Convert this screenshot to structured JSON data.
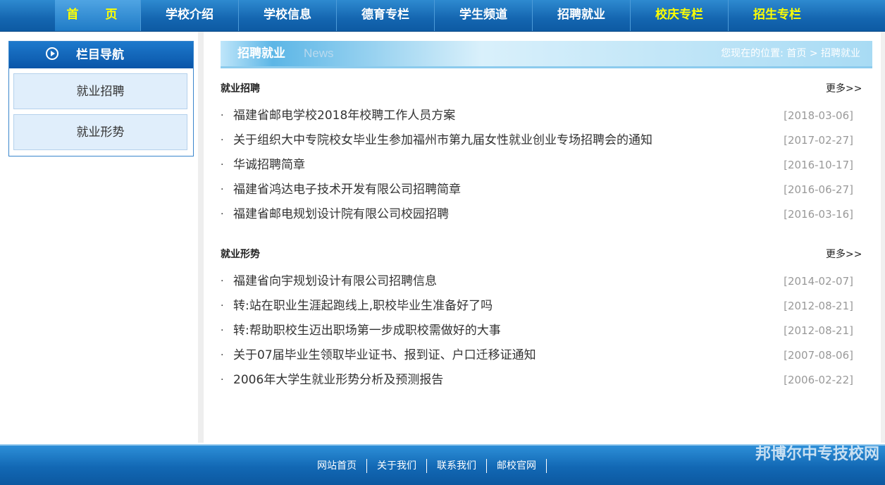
{
  "nav": {
    "items": [
      {
        "label": "首 页",
        "color": "#ffff00"
      },
      {
        "label": "学校介绍"
      },
      {
        "label": "学校信息"
      },
      {
        "label": "德育专栏"
      },
      {
        "label": "学生频道"
      },
      {
        "label": "招聘就业"
      },
      {
        "label": "校庆专栏",
        "color": "#ffff00"
      },
      {
        "label": "招生专栏",
        "color": "#ffff00"
      }
    ]
  },
  "sidebar": {
    "title": "栏目导航",
    "items": [
      "就业招聘",
      "就业形势"
    ]
  },
  "content": {
    "title": "招聘就业",
    "subtitle": "News",
    "breadcrumb": {
      "prefix": "您现在的位置:",
      "home": "首页",
      "sep": ">",
      "current": "招聘就业"
    },
    "sections": [
      {
        "title": "就业招聘",
        "more": "更多>>",
        "items": [
          {
            "title": "福建省邮电学校2018年校聘工作人员方案",
            "date": "[2018-03-06]"
          },
          {
            "title": "关于组织大中专院校女毕业生参加福州市第九届女性就业创业专场招聘会的通知",
            "date": "[2017-02-27]"
          },
          {
            "title": "华诚招聘简章",
            "date": "[2016-10-17]"
          },
          {
            "title": "福建省鸿达电子技术开发有限公司招聘简章",
            "date": "[2016-06-27]"
          },
          {
            "title": "福建省邮电规划设计院有限公司校园招聘",
            "date": "[2016-03-16]"
          }
        ]
      },
      {
        "title": "就业形势",
        "more": "更多>>",
        "items": [
          {
            "title": "福建省向宇规划设计有限公司招聘信息",
            "date": "[2014-02-07]"
          },
          {
            "title": "转:站在职业生涯起跑线上,职校毕业生准备好了吗",
            "date": "[2012-08-21]"
          },
          {
            "title": "转:帮助职校生迈出职场第一步成职校需做好的大事",
            "date": "[2012-08-21]"
          },
          {
            "title": "关于07届毕业生领取毕业证书、报到证、户口迁移证通知",
            "date": "[2007-08-06]"
          },
          {
            "title": "2006年大学生就业形势分析及预测报告",
            "date": "[2006-02-22]"
          }
        ]
      }
    ]
  },
  "footer": {
    "links": [
      "网站首页",
      "关于我们",
      "联系我们",
      "邮校官网"
    ]
  },
  "watermark": "邦博尔中专技校网",
  "colors": {
    "nav_bg": "#1466b0",
    "highlight": "#ffff00",
    "date": "#999999"
  }
}
